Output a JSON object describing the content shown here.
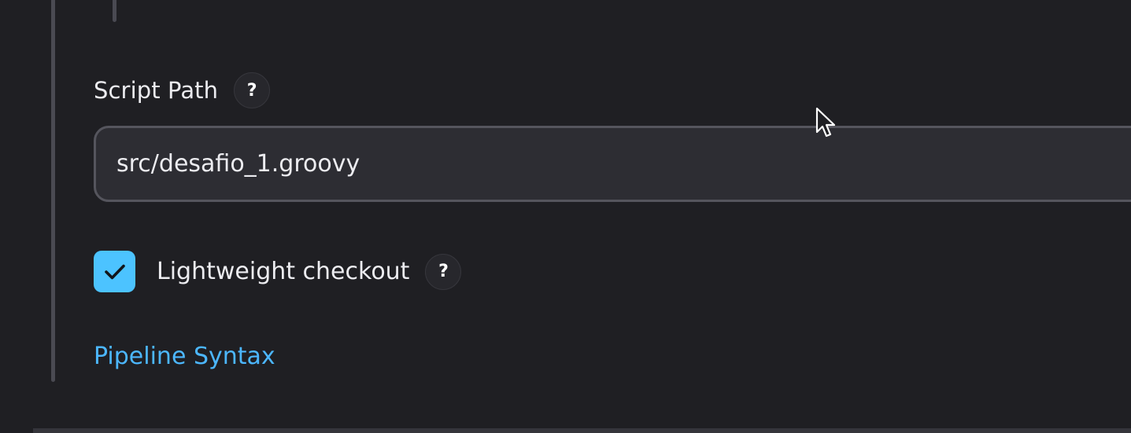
{
  "script_path": {
    "label": "Script Path",
    "help_glyph": "?",
    "value": "src/desafio_1.groovy"
  },
  "lightweight_checkout": {
    "label": "Lightweight checkout",
    "checked": true,
    "help_glyph": "?"
  },
  "pipeline_syntax_link": {
    "label": "Pipeline Syntax"
  },
  "colors": {
    "background": "#1f1f23",
    "input_background": "#2d2d33",
    "input_border": "#55555d",
    "accent": "#4cc3ff",
    "link": "#4cb7ff",
    "text": "#ececf0"
  },
  "icons": {
    "checkmark": "check-icon",
    "cursor": "mouse-pointer-icon"
  }
}
